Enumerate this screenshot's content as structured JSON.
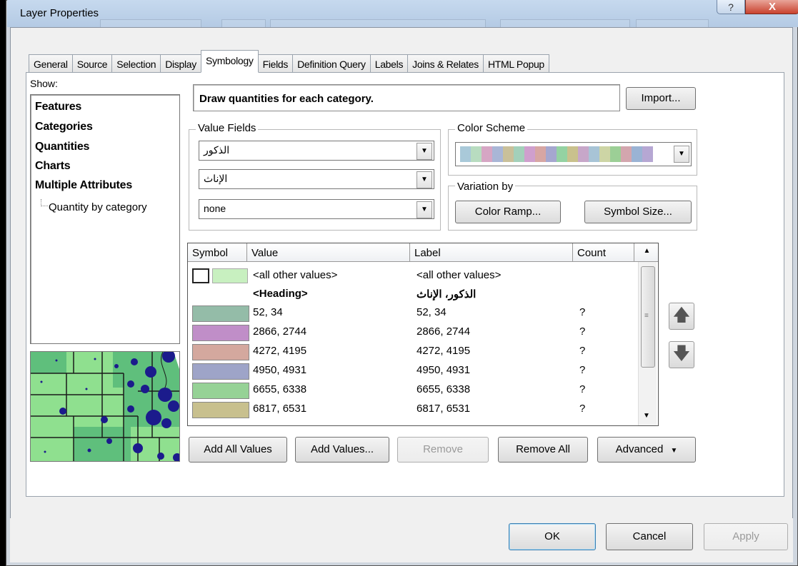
{
  "window": {
    "title": "Layer Properties",
    "help_glyph": "?",
    "close_glyph": "X"
  },
  "tabs": [
    "General",
    "Source",
    "Selection",
    "Display",
    "Symbology",
    "Fields",
    "Definition Query",
    "Labels",
    "Joins & Relates",
    "HTML Popup"
  ],
  "active_tab": "Symbology",
  "show": {
    "label": "Show:",
    "items": [
      "Features",
      "Categories",
      "Quantities",
      "Charts",
      "Multiple Attributes"
    ],
    "subitem": "Quantity by category"
  },
  "description": "Draw quantities for each category.",
  "import_label": "Import...",
  "value_fields": {
    "label": "Value Fields",
    "fields": [
      "الذكور",
      "الإناث",
      "none"
    ]
  },
  "color_scheme": {
    "label": "Color Scheme",
    "swatches": [
      "#a9c9d9",
      "#b8dcc0",
      "#d6a6c4",
      "#a9b6d6",
      "#c9c09a",
      "#a3d0ba",
      "#cf9fcd",
      "#d7a6a3",
      "#a5a7cf",
      "#94d2a2",
      "#c9c18d",
      "#c7a7c9",
      "#a8c4d6",
      "#cdd5a5",
      "#9ccf96",
      "#d3a6ae",
      "#9ab3d4",
      "#b6a7d3"
    ]
  },
  "variation": {
    "label": "Variation by",
    "color_ramp": "Color Ramp...",
    "symbol_size": "Symbol Size..."
  },
  "table": {
    "headers": [
      "Symbol",
      "Value",
      "Label",
      "Count"
    ],
    "all_other": {
      "value": "<all other values>",
      "label": "<all other values>",
      "color": "#c8f0c0"
    },
    "heading": {
      "value": "<Heading>",
      "label": "الذكور، الإناث"
    },
    "rows": [
      {
        "value": "52, 34",
        "label": "52, 34",
        "count": "?",
        "color": "#94bca8"
      },
      {
        "value": "2866, 2744",
        "label": "2866, 2744",
        "count": "?",
        "color": "#c08ec8"
      },
      {
        "value": "4272, 4195",
        "label": "4272, 4195",
        "count": "?",
        "color": "#d4a89e"
      },
      {
        "value": "4950, 4931",
        "label": "4950, 4931",
        "count": "?",
        "color": "#9ea4c8"
      },
      {
        "value": "6655, 6338",
        "label": "6655, 6338",
        "count": "?",
        "color": "#96d296"
      },
      {
        "value": "6817, 6531",
        "label": "6817, 6531",
        "count": "?",
        "color": "#c8c08e"
      }
    ]
  },
  "buttons": {
    "add_all": "Add All Values",
    "add_values": "Add Values...",
    "remove": "Remove",
    "remove_all": "Remove All",
    "advanced": "Advanced",
    "ok": "OK",
    "cancel": "Cancel",
    "apply": "Apply"
  },
  "colors": {
    "map_land": "#8fe08f",
    "map_dark": "#5fbf7c",
    "map_dots": "#1b1b8c"
  }
}
